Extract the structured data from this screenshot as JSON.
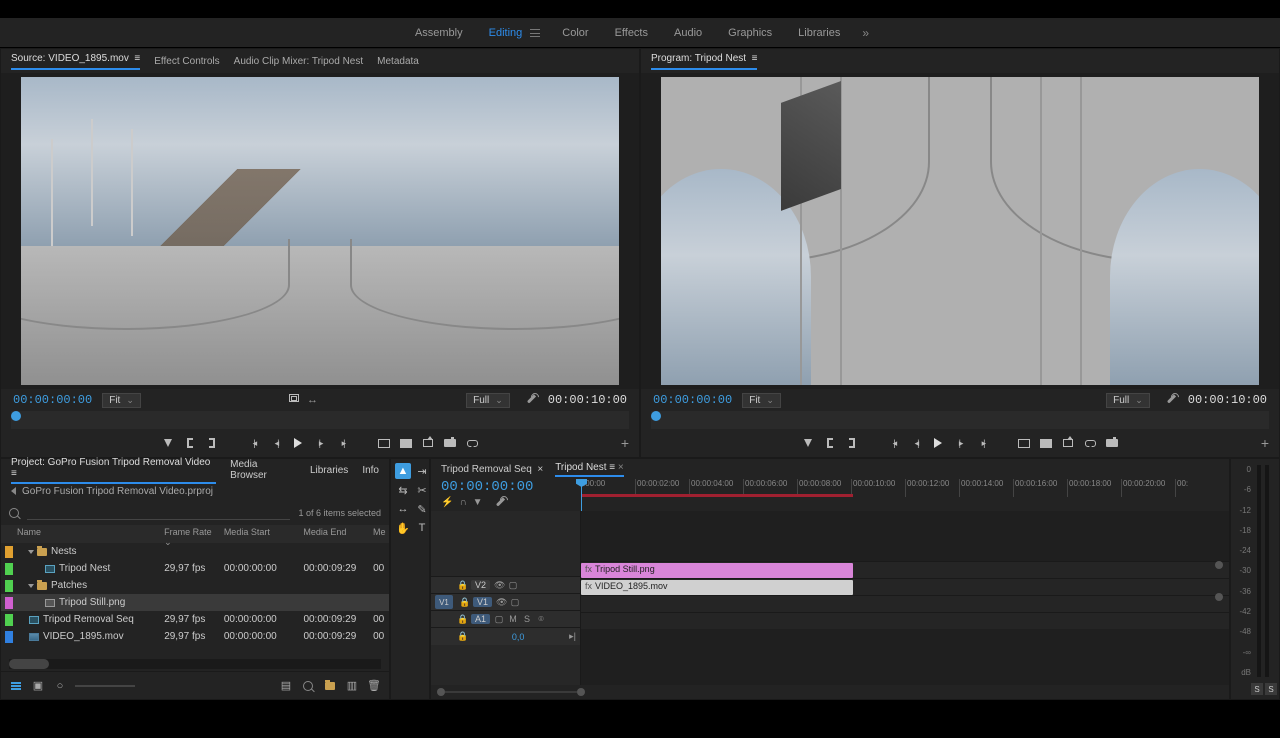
{
  "workspace_tabs": [
    "Assembly",
    "Editing",
    "Color",
    "Effects",
    "Audio",
    "Graphics",
    "Libraries"
  ],
  "workspace_active": "Editing",
  "source": {
    "tabs": [
      "Source: VIDEO_1895.mov",
      "Effect Controls",
      "Audio Clip Mixer: Tripod Nest",
      "Metadata"
    ],
    "active": "Source: VIDEO_1895.mov",
    "tc_in": "00:00:00:00",
    "tc_out": "00:00:10:00",
    "fit": "Fit",
    "full": "Full"
  },
  "program": {
    "label": "Program: Tripod Nest",
    "tc_in": "00:00:00:00",
    "tc_out": "00:00:10:00",
    "fit": "Fit",
    "full": "Full"
  },
  "project": {
    "tabs": [
      "Project: GoPro Fusion Tripod Removal Video",
      "Media Browser",
      "Libraries",
      "Info"
    ],
    "active": "Project: GoPro Fusion Tripod Removal Video",
    "file": "GoPro Fusion Tripod Removal Video.prproj",
    "selection": "1 of 6 items selected",
    "columns": [
      "Name",
      "Frame Rate",
      "Media Start",
      "Media End",
      "Me"
    ],
    "rows": [
      {
        "label": "#e0a030",
        "indent": 1,
        "type": "bin",
        "open": true,
        "name": "Nests",
        "fr": "",
        "ms": "",
        "me": "",
        "md": ""
      },
      {
        "label": "#50d050",
        "indent": 2,
        "type": "seq",
        "name": "Tripod Nest",
        "fr": "29,97 fps",
        "ms": "00:00:00:00",
        "me": "00:00:09:29",
        "md": "00"
      },
      {
        "label": "#50d050",
        "indent": 1,
        "type": "bin",
        "open": true,
        "name": "Patches",
        "fr": "",
        "ms": "",
        "me": "",
        "md": ""
      },
      {
        "label": "#d060d0",
        "indent": 2,
        "type": "img",
        "name": "Tripod Still.png",
        "fr": "",
        "ms": "",
        "me": "",
        "md": "",
        "selected": true
      },
      {
        "label": "#50d050",
        "indent": 1,
        "type": "seq",
        "name": "Tripod Removal Seq",
        "fr": "29,97 fps",
        "ms": "00:00:00:00",
        "me": "00:00:09:29",
        "md": "00"
      },
      {
        "label": "#3080e0",
        "indent": 1,
        "type": "vid",
        "name": "VIDEO_1895.mov",
        "fr": "29,97 fps",
        "ms": "00:00:00:00",
        "me": "00:00:09:29",
        "md": "00"
      }
    ]
  },
  "timeline": {
    "tabs": [
      {
        "name": "Tripod Removal Seq",
        "closable": false
      },
      {
        "name": "Tripod Nest",
        "closable": true,
        "active": true
      }
    ],
    "tc": "00:00:00:00",
    "ticks": [
      ":00:00",
      "00:00:02:00",
      "00:00:04:00",
      "00:00:06:00",
      "00:00:08:00",
      "00:00:10:00",
      "00:00:12:00",
      "00:00:14:00",
      "00:00:16:00",
      "00:00:18:00",
      "00:00:20:00",
      "00:"
    ],
    "tracks": {
      "v2": {
        "name": "V2",
        "clip": "Tripod Still.png",
        "color": "v2"
      },
      "v1": {
        "name": "V1",
        "src": "V1",
        "clip": "VIDEO_1895.mov",
        "color": "v1"
      },
      "a1": {
        "name": "A1",
        "mute": "M",
        "solo": "S"
      },
      "master_level": "0,0"
    }
  },
  "meters": {
    "scale": [
      "0",
      "-6",
      "-12",
      "-18",
      "-24",
      "-30",
      "-36",
      "-42",
      "-48",
      "-∞",
      "dB"
    ],
    "solo": "S"
  }
}
